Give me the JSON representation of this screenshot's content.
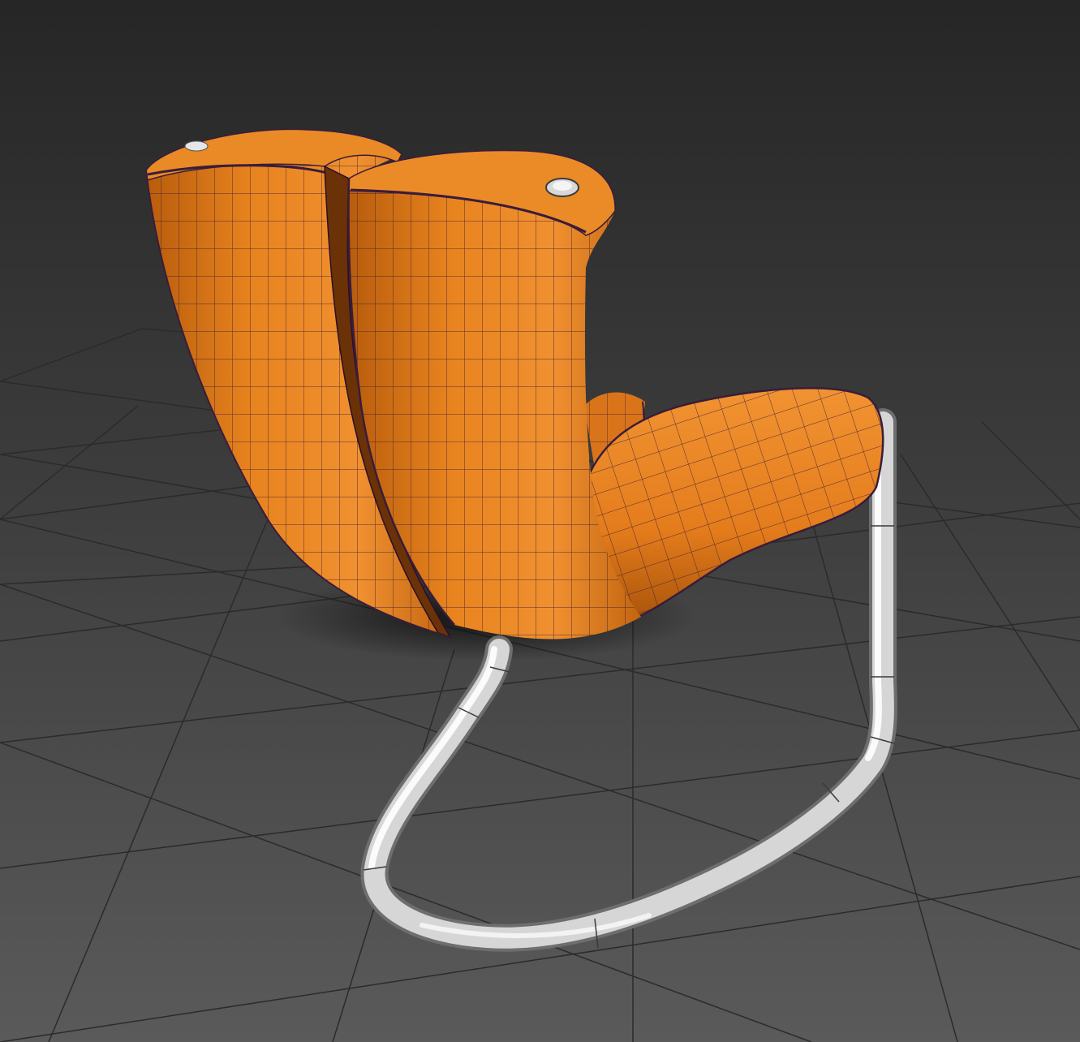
{
  "viewport": {
    "background_top": "#262626",
    "background_bottom": "#5a5a5a",
    "grid_line_color": "#2b2b2b"
  },
  "model": {
    "upholstery_color": "#e07a1a",
    "upholstery_shade": "#9a4a08",
    "wireframe_color": "#3a1c3a",
    "frame_color": "#d8d8d8",
    "frame_shade": "#8a8a8a"
  }
}
